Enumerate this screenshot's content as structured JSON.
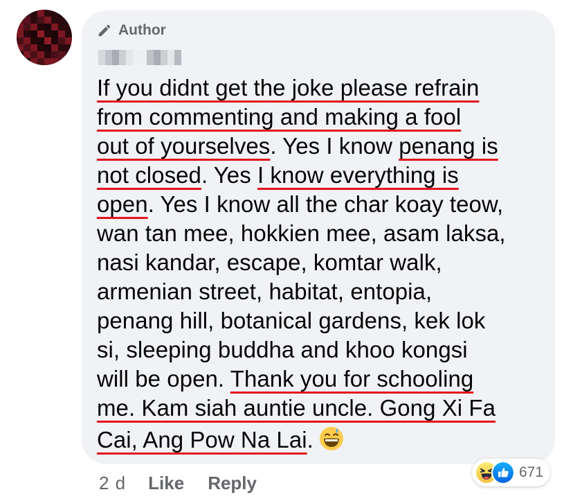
{
  "comment": {
    "badge": {
      "icon": "pencil-icon",
      "label": "Author"
    },
    "lines": [
      [
        {
          "text": "If you didnt get the joke please refrain",
          "underline": true
        }
      ],
      [
        {
          "text": "from commenting and making a fool",
          "underline": true
        }
      ],
      [
        {
          "text": "out of yourselves",
          "underline": true
        },
        {
          "text": ". Yes I know ",
          "underline": false
        },
        {
          "text": "penang is",
          "underline": true
        }
      ],
      [
        {
          "text": "not closed",
          "underline": true
        },
        {
          "text": ". Yes ",
          "underline": false
        },
        {
          "text": "I know everything is",
          "underline": true
        }
      ],
      [
        {
          "text": "open",
          "underline": true
        },
        {
          "text": ". Yes I know all the char koay teow,",
          "underline": false
        }
      ],
      [
        {
          "text": "wan tan mee, hokkien mee, asam laksa,",
          "underline": false
        }
      ],
      [
        {
          "text": "nasi kandar, escape, komtar walk,",
          "underline": false
        }
      ],
      [
        {
          "text": "armenian street, habitat, entopia,",
          "underline": false
        }
      ],
      [
        {
          "text": "penang hill, botanical gardens, kek lok",
          "underline": false
        }
      ],
      [
        {
          "text": "si, sleeping buddha and khoo kongsi",
          "underline": false
        }
      ],
      [
        {
          "text": "will be open. ",
          "underline": false
        },
        {
          "text": "Thank you for schooling",
          "underline": true
        }
      ],
      [
        {
          "text": "me. Kam siah auntie uncle. Gong Xi Fa",
          "underline": true
        }
      ],
      [
        {
          "text": "Cai, Ang Pow Na Lai",
          "underline": true
        },
        {
          "text": ".",
          "underline": false
        }
      ]
    ],
    "trailing_emoji": "grinning-sweat-emoji",
    "underline_color": "#e2131e"
  },
  "reactions": {
    "icons": [
      "laughing-emoji-icon",
      "thumbs-up-icon"
    ],
    "count": "671"
  },
  "actions": {
    "time": "2 d",
    "like_label": "Like",
    "reply_label": "Reply"
  },
  "colors": {
    "bubble": "#f0f2f5",
    "text": "#050505",
    "secondary": "#65676b",
    "like_blue": "#1877f2"
  }
}
